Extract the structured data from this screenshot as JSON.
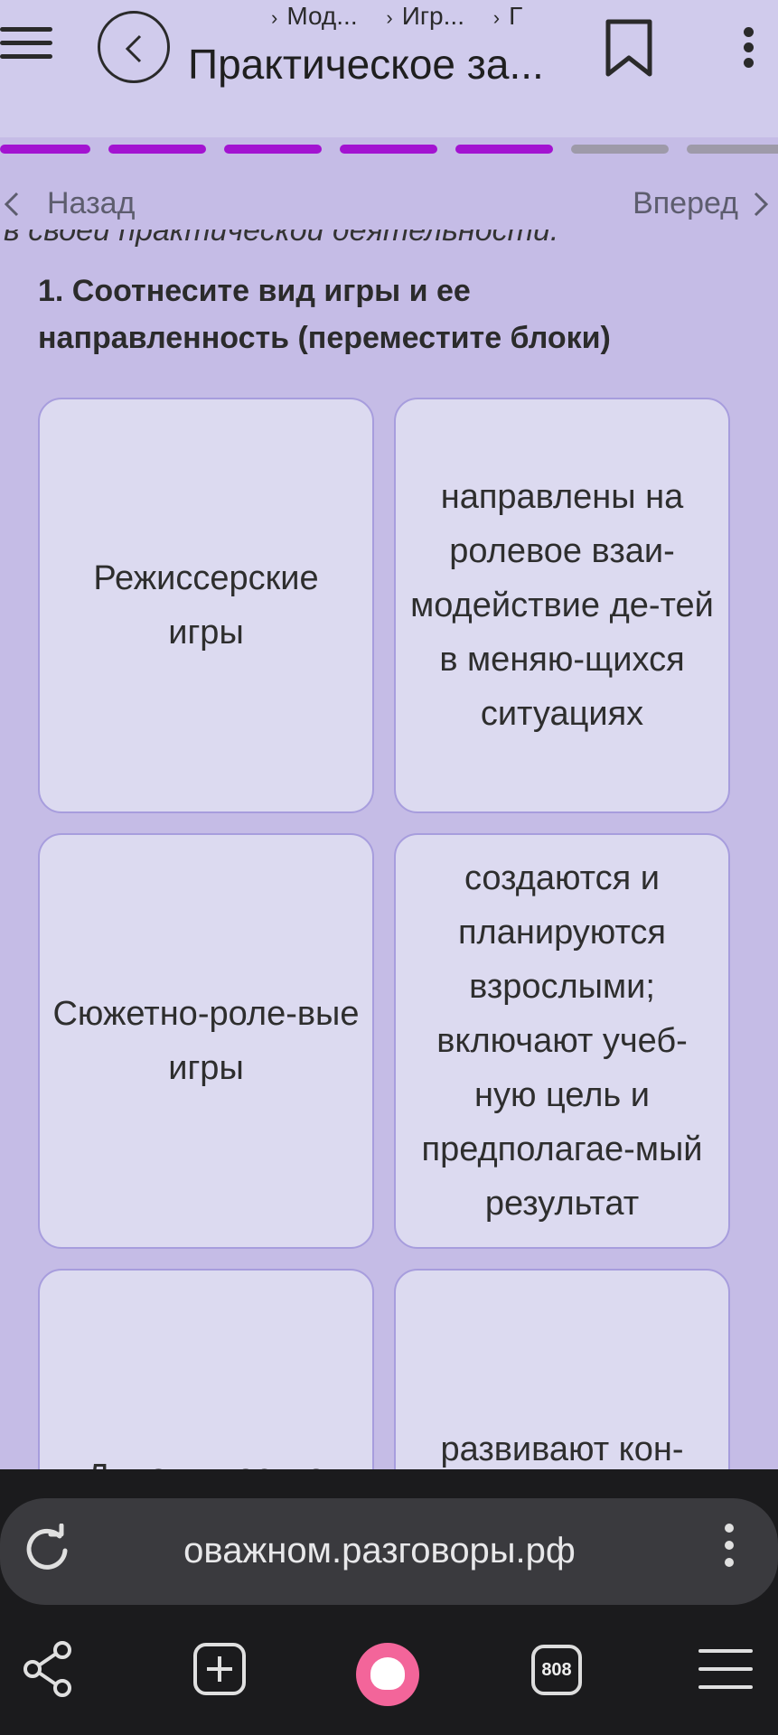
{
  "header": {
    "breadcrumbs": [
      "Мод...",
      "Игр...",
      "Г"
    ],
    "title": "Практическое за..."
  },
  "progress": {
    "completed_segments": 5,
    "total_segments": 7,
    "active_color": "#a313d1",
    "inactive_color": "#9e9aa9"
  },
  "nav": {
    "back_label": "Назад",
    "forward_label": "Вперед"
  },
  "content": {
    "clipped_text": "в своей практической деятельности.",
    "question": "1.  Соотнесите вид игры и ее направленность (переместите блоки)"
  },
  "cards": [
    {
      "left": "Режиссерские игры",
      "right": "направлены на ролевое взаи-модействие де-тей в меняю-щихся ситуациях"
    },
    {
      "left": "Сюжетно-роле-вые игры",
      "right": "создаются и планируются взрослыми; включают учеб-ную цель и предполагае-мый результат"
    },
    {
      "left": "Дидактические",
      "right": "развивают кон-структивные"
    }
  ],
  "browser": {
    "url": "оважном.разговоры.рф",
    "tabs_count": "808",
    "bottom_icons": [
      "share-icon",
      "new-tab-icon",
      "alice-assistant-icon",
      "tabs-icon",
      "menu-icon"
    ]
  }
}
